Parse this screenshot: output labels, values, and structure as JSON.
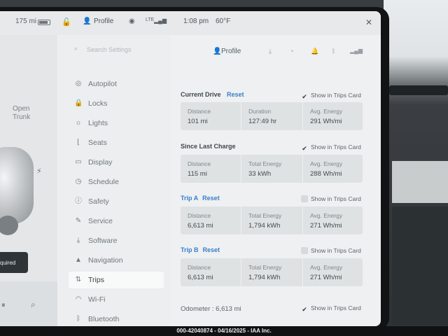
{
  "status_bar": {
    "range": "175 mi",
    "profile": "Profile",
    "signal": "LTE",
    "time": "1:08 pm",
    "temp": "60°F"
  },
  "car_panel": {
    "open_trunk": "Open\nTrunk",
    "required_badge": "quired"
  },
  "nav": {
    "search_placeholder": "Search Settings",
    "items": [
      {
        "label": "Autopilot",
        "icon": "steering-wheel-icon"
      },
      {
        "label": "Locks",
        "icon": "lock-icon"
      },
      {
        "label": "Lights",
        "icon": "light-icon"
      },
      {
        "label": "Seats",
        "icon": "seat-icon"
      },
      {
        "label": "Display",
        "icon": "display-icon"
      },
      {
        "label": "Schedule",
        "icon": "clock-icon"
      },
      {
        "label": "Safety",
        "icon": "safety-icon"
      },
      {
        "label": "Service",
        "icon": "wrench-icon"
      },
      {
        "label": "Software",
        "icon": "download-icon"
      },
      {
        "label": "Navigation",
        "icon": "navigation-icon"
      },
      {
        "label": "Trips",
        "icon": "trips-icon",
        "active": true
      },
      {
        "label": "Wi-Fi",
        "icon": "wifi-icon"
      },
      {
        "label": "Bluetooth",
        "icon": "bluetooth-icon"
      }
    ]
  },
  "main": {
    "profile": "Profile",
    "show_in_trips_card": "Show in Trips Card",
    "reset": "Reset",
    "current_drive": {
      "title": "Current Drive",
      "checked": true,
      "stats": [
        {
          "label": "Distance",
          "value": "101 mi"
        },
        {
          "label": "Duration",
          "value": "127:49 hr"
        },
        {
          "label": "Avg. Energy",
          "value": "291 Wh/mi"
        }
      ]
    },
    "since_last_charge": {
      "title": "Since Last Charge",
      "checked": true,
      "stats": [
        {
          "label": "Distance",
          "value": "115 mi"
        },
        {
          "label": "Total Energy",
          "value": "33 kWh"
        },
        {
          "label": "Avg. Energy",
          "value": "288 Wh/mi"
        }
      ]
    },
    "trip_a": {
      "title": "Trip A",
      "checked": false,
      "stats": [
        {
          "label": "Distance",
          "value": "6,613 mi"
        },
        {
          "label": "Total Energy",
          "value": "1,794 kWh"
        },
        {
          "label": "Avg. Energy",
          "value": "271 Wh/mi"
        }
      ]
    },
    "trip_b": {
      "title": "Trip B",
      "checked": false,
      "stats": [
        {
          "label": "Distance",
          "value": "6,613 mi"
        },
        {
          "label": "Total Energy",
          "value": "1,794 kWh"
        },
        {
          "label": "Avg. Energy",
          "value": "271 Wh/mi"
        }
      ]
    },
    "odometer": {
      "label": "Odometer : 6,613 mi",
      "checked": true
    }
  },
  "caption": "000-42040874 - 04/16/2025 - IAA Inc.",
  "colors": {
    "accent": "#3a7ecb",
    "screen_bg": "#eef0f1"
  }
}
